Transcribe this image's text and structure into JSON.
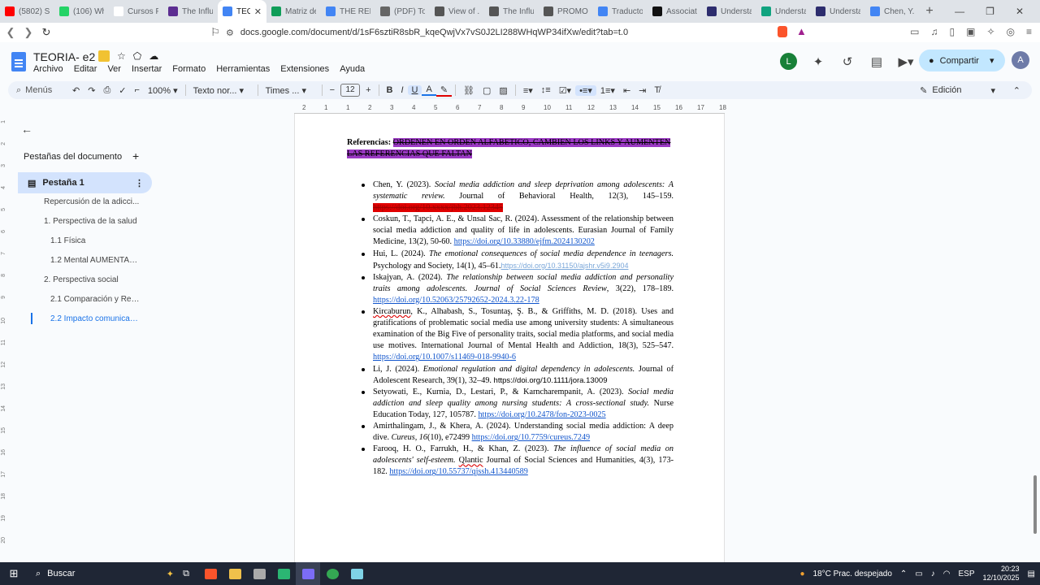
{
  "browser": {
    "tabs": [
      {
        "title": "(5802) Si...",
        "color": "#ff0000"
      },
      {
        "title": "(106) Wh...",
        "color": "#25d366"
      },
      {
        "title": "Cursos Pl...",
        "color": "#ffffff"
      },
      {
        "title": "The Influ...",
        "color": "#5c2d91"
      },
      {
        "title": "TEORI",
        "color": "#4285f4",
        "active": true
      },
      {
        "title": "Matriz de",
        "color": "#0f9d58"
      },
      {
        "title": "THE RELA...",
        "color": "#4285f4"
      },
      {
        "title": "(PDF) To...",
        "color": "#666666"
      },
      {
        "title": "View of ...",
        "color": "#555555"
      },
      {
        "title": "The Influ...",
        "color": "#555555"
      },
      {
        "title": "PROMOT...",
        "color": "#555555"
      },
      {
        "title": "Traductor",
        "color": "#4285f4"
      },
      {
        "title": "Associati...",
        "color": "#111111"
      },
      {
        "title": "Understa...",
        "color": "#2d2d6e"
      },
      {
        "title": "Understa...",
        "color": "#10a37f"
      },
      {
        "title": "Understa...",
        "color": "#2d2d6e"
      },
      {
        "title": "Chen, Y...",
        "color": "#4285f4"
      }
    ],
    "close_label": "✕",
    "new_tab": "+",
    "url": "docs.google.com/document/d/1sF6sztiR8sbR_kqeQwjVx7vS0J2LI288WHqWP34ifXw/edit?tab=t.0"
  },
  "docs": {
    "title": "TEORIA- e2 -",
    "menus": [
      "Archivo",
      "Editar",
      "Ver",
      "Insertar",
      "Formato",
      "Herramientas",
      "Extensiones",
      "Ayuda"
    ],
    "avatar_letter": "L",
    "share_label": "Compartir",
    "account_letter": "A"
  },
  "toolbar": {
    "search": "Menús",
    "zoom": "100%",
    "style": "Texto nor...",
    "font": "Times ...",
    "font_size": "12",
    "mode": "Edición"
  },
  "ruler": [
    "2",
    "1",
    "1",
    "2",
    "3",
    "4",
    "5",
    "6",
    "7",
    "8",
    "9",
    "10",
    "11",
    "12",
    "13",
    "14",
    "15",
    "16",
    "17",
    "18"
  ],
  "vruler": [
    "1",
    "2",
    "3",
    "4",
    "5",
    "6",
    "7",
    "8",
    "9",
    "10",
    "11",
    "12",
    "13",
    "14",
    "15",
    "16",
    "17",
    "18",
    "19",
    "20"
  ],
  "sidebar": {
    "heading": "Pestañas del documento",
    "tab_label": "Pestaña 1",
    "outline": [
      {
        "text": "Repercusión de la adicci...",
        "indent": 0
      },
      {
        "text": "1. Perspectiva de la salud",
        "indent": 0
      },
      {
        "text": "1.1 Física",
        "indent": 1
      },
      {
        "text": "1.2 Mental AUMENTAR ...",
        "indent": 1
      },
      {
        "text": "2. Perspectiva social",
        "indent": 0
      },
      {
        "text": "2.1 Comparación y Rec...",
        "indent": 1
      },
      {
        "text": "2.2 Impacto comunicati...",
        "indent": 1,
        "active": true
      }
    ]
  },
  "document": {
    "ref_label": "Referencias:",
    "ref_note": "ORDENEN EN ORDEN ALFABETICO, CAMBIEN LOS LINKS Y AUMENTEN LAS REFERENCIAS QUE FALTAN",
    "refs": {
      "r1_a": "Chen, Y. (2023). ",
      "r1_b": "Social media addiction and sleep deprivation among adolescents: A systematic review.",
      "r1_c": " Journal of Behavioral Health, 12(3), 145–159. ",
      "r1_d": "https://doi.org/10.xxxx/jbh.2023.12345",
      "r2_a": "Coskun, T., Tapci, A. E., & Unsal Sac, R. (2024). Assessment of the relationship between social media addiction and quality of life in adolescents. Eurasian Journal of Family Medicine, 13(2), 50-60. ",
      "r2_b": "https://doi.org/10.33880/ejfm.2024130202",
      "r3_a": "Hui, L. (2024). ",
      "r3_b": "The emotional consequences of social media dependence in teenagers.",
      "r3_c": " Psychology and Society, 14(1), 45–61.",
      "r3_d": "https://doi.org/10.31150/ajshr.v5i9.2904",
      "r4_a": "Iskajyan, A. (2024). ",
      "r4_b": "The relationship between social media addiction and personality traits among adolescents. Journal of Social Sciences Review",
      "r4_c": ", 3(22), 178–189. ",
      "r4_d": "https://doi.org/10.52063/25792652-2024.3.22-178",
      "r5_a": "Kircaburun",
      "r5_b": ", K., Alhabash, S., Tosuntaş, Ş. B., & Griffiths, M. D. (2018). Uses and gratifications of problematic social media use among university students: A simultaneous examination of the Big Five of personality traits, social media platforms, and social media use motives. International Journal of Mental Health and Addiction, 18(3), 525–547. ",
      "r5_c": "https://doi.org/10.1007/s11469-018-9940-6",
      "r6_a": "Li, J. (2024). ",
      "r6_b": "Emotional regulation and digital dependency in adolescents.",
      "r6_c": " Journal of Adolescent Research, 39(1), 32–49. ",
      "r6_d": "https://doi.org/10.1111/jora.13009",
      "r7_a": "Setyowati, E., Kurnia, D., Lestari, P., & Karncharempanit, A. (2023). ",
      "r7_b": "Social media addiction and sleep quality among nursing students: A cross-sectional study.",
      "r7_c": " Nurse Education Today, 127, 105787. ",
      "r7_d": "https://doi.org/10.2478/fon-2023-0025",
      "r8_a": "Amirthalingam, J., & Khera, A. (2024). Understanding social media addiction: A deep dive. ",
      "r8_b": "Cureus, 16",
      "r8_c": "(10), e72499 ",
      "r8_d": "https://doi.org/10.7759/cureus.7249",
      "r9_a": "Farooq, H. O., Farrukh, H., & Khan, Z. (2023). ",
      "r9_b": "The influence of social media on adolescents' self-esteem.",
      "r9_c": " ",
      "r9_d": "Qlantic",
      "r9_e": " Journal of Social Sciences and Humanities, 4(3), 173-182. ",
      "r9_f": "https://doi.org/10.55737/qjssh.413440589"
    }
  },
  "taskbar": {
    "search": "Buscar",
    "weather": "18°C  Prac. despejado",
    "lang": "ESP",
    "time": "20:23",
    "date": "12/10/2025"
  }
}
